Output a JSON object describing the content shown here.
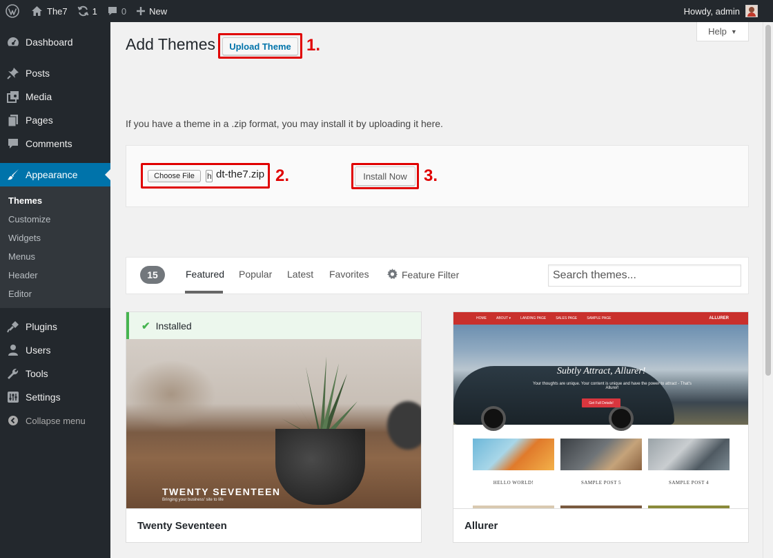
{
  "admin_bar": {
    "site_name": "The7",
    "updates_count": "1",
    "comments_count": "0",
    "new_label": "New",
    "howdy": "Howdy, admin"
  },
  "sidebar": {
    "items": [
      {
        "label": "Dashboard",
        "icon": "dashboard-icon"
      },
      {
        "label": "Posts",
        "icon": "pin-icon"
      },
      {
        "label": "Media",
        "icon": "media-icon"
      },
      {
        "label": "Pages",
        "icon": "pages-icon"
      },
      {
        "label": "Comments",
        "icon": "comment-icon"
      },
      {
        "label": "Appearance",
        "icon": "brush-icon"
      },
      {
        "label": "Plugins",
        "icon": "plugin-icon"
      },
      {
        "label": "Users",
        "icon": "user-icon"
      },
      {
        "label": "Tools",
        "icon": "wrench-icon"
      },
      {
        "label": "Settings",
        "icon": "settings-icon"
      },
      {
        "label": "Collapse menu",
        "icon": "collapse-icon"
      }
    ],
    "submenu": [
      "Themes",
      "Customize",
      "Widgets",
      "Menus",
      "Header",
      "Editor"
    ]
  },
  "help": {
    "label": "Help"
  },
  "page": {
    "title": "Add Themes",
    "upload_button": "Upload Theme",
    "upload_description": "If you have a theme in a .zip format, you may install it by uploading it here.",
    "choose_file": "Choose File",
    "file_cursor": "h",
    "file_name": "dt-the7.zip",
    "install_button": "Install Now"
  },
  "markers": [
    "1.",
    "2.",
    "3."
  ],
  "filter": {
    "count": "15",
    "tabs": [
      "Featured",
      "Popular",
      "Latest",
      "Favorites"
    ],
    "feature_filter": "Feature Filter",
    "search_placeholder": "Search themes..."
  },
  "themes": [
    {
      "name": "Twenty Seventeen",
      "installed_label": "Installed",
      "screenshot_title": "TWENTY SEVENTEEN",
      "screenshot_subtitle": "Bringing your business' site to life"
    },
    {
      "name": "Allurer",
      "nav_items": [
        "HOME",
        "ABOUT ▾",
        "LANDING PAGE",
        "SALES PAGE",
        "SAMPLE PAGE"
      ],
      "brand": "ALLURER",
      "hero_heading": "Subtly Attract, Allurer!",
      "hero_text": "Your thoughts are unique. Your content is unique and have the power to attract - That's Allurer!",
      "cta": "Get Full Details!",
      "posts": [
        "HELLO WORLD!",
        "SAMPLE POST 5",
        "SAMPLE POST 4"
      ]
    }
  ],
  "colors": {
    "admin_bg": "#23282d",
    "accent": "#0073aa",
    "annotation_red": "#e00000",
    "installed_green": "#46b450"
  }
}
